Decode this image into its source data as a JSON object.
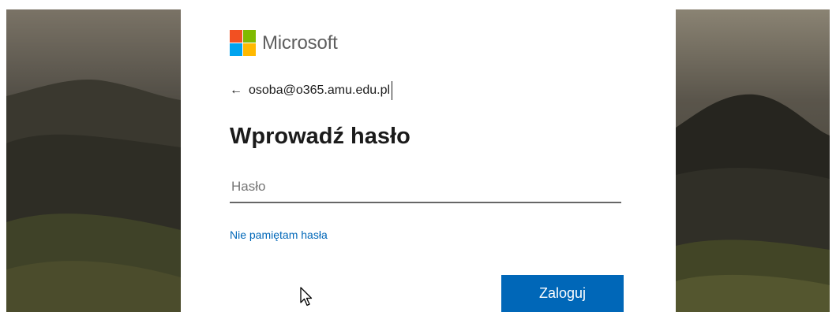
{
  "brand": {
    "name": "Microsoft",
    "colors": [
      "#f25022",
      "#7fba00",
      "#00a4ef",
      "#ffb900"
    ]
  },
  "identity": {
    "back_icon": "back-arrow-icon",
    "email": "osoba@o365.amu.edu.pl"
  },
  "heading": "Wprowadź hasło",
  "password_field": {
    "placeholder": "Hasło",
    "value": ""
  },
  "forgot_link": "Nie pamiętam hasła",
  "submit_label": "Zaloguj",
  "theme": {
    "accent": "#0067b8",
    "text": "#1b1b1b"
  }
}
